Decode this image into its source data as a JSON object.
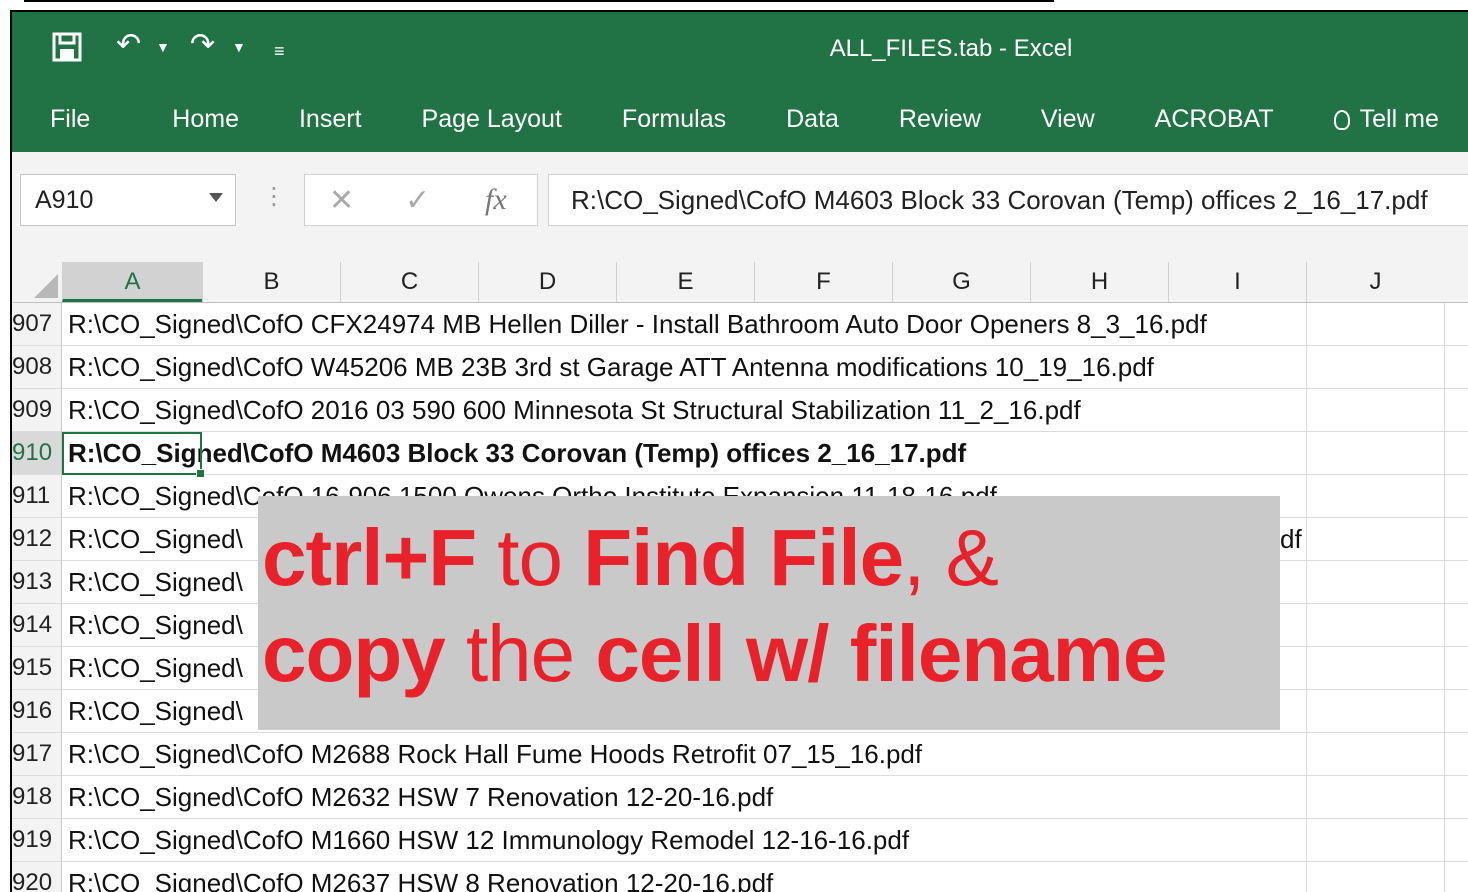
{
  "window": {
    "title": "ALL_FILES.tab - Excel"
  },
  "ribbon": {
    "tabs": [
      "File",
      "Home",
      "Insert",
      "Page Layout",
      "Formulas",
      "Data",
      "Review",
      "View",
      "ACROBAT"
    ],
    "tell_me": "Tell me"
  },
  "formula_bar": {
    "name_box": "A910",
    "formula": "R:\\CO_Signed\\CofO M4603 Block 33 Corovan (Temp) offices 2_16_17.pdf"
  },
  "columns": [
    "A",
    "B",
    "C",
    "D",
    "E",
    "F",
    "G",
    "H",
    "I",
    "J"
  ],
  "selected_column": "A",
  "rows": [
    {
      "num": "907",
      "value": "R:\\CO_Signed\\CofO CFX24974 MB Hellen Diller - Install Bathroom Auto Door Openers 8_3_16.pdf"
    },
    {
      "num": "908",
      "value": "R:\\CO_Signed\\CofO W45206 MB 23B 3rd st Garage  ATT Antenna modifications 10_19_16.pdf"
    },
    {
      "num": "909",
      "value": "R:\\CO_Signed\\CofO 2016 03 590  600 Minnesota St Structural Stabilization 11_2_16.pdf"
    },
    {
      "num": "910",
      "value": "R:\\CO_Signed\\CofO M4603 Block 33 Corovan (Temp) offices 2_16_17.pdf"
    },
    {
      "num": "911",
      "value": "R:\\CO_Signed\\CofO 16-906 1500 Owens Ortho Institute Expansion 11-18-16.pdf"
    },
    {
      "num": "912",
      "value": "R:\\CO_Signed\\"
    },
    {
      "num": "913",
      "value": "R:\\CO_Signed\\"
    },
    {
      "num": "914",
      "value": "R:\\CO_Signed\\"
    },
    {
      "num": "915",
      "value": "R:\\CO_Signed\\"
    },
    {
      "num": "916",
      "value": "R:\\CO_Signed\\"
    },
    {
      "num": "917",
      "value": "R:\\CO_Signed\\CofO M2688 Rock Hall Fume Hoods Retrofit 07_15_16.pdf"
    },
    {
      "num": "918",
      "value": "R:\\CO_Signed\\CofO M2632 HSW 7 Renovation 12-20-16.pdf"
    },
    {
      "num": "919",
      "value": "R:\\CO_Signed\\CofO M1660 HSW 12 Immunology Remodel 12-16-16.pdf"
    },
    {
      "num": "920",
      "value": "R:\\CO_Signed\\CofO M2637 HSW 8 Renovation 12-20-16.pdf"
    }
  ],
  "row_912_tail": "df",
  "active_row": "910",
  "overlay": {
    "line1": [
      "ctrl+F",
      " to ",
      "Find File",
      ", &"
    ],
    "line2": [
      "copy",
      " the ",
      "cell w/ filename"
    ],
    "color": "#e8212a"
  },
  "colors": {
    "excel_green": "#217346"
  }
}
